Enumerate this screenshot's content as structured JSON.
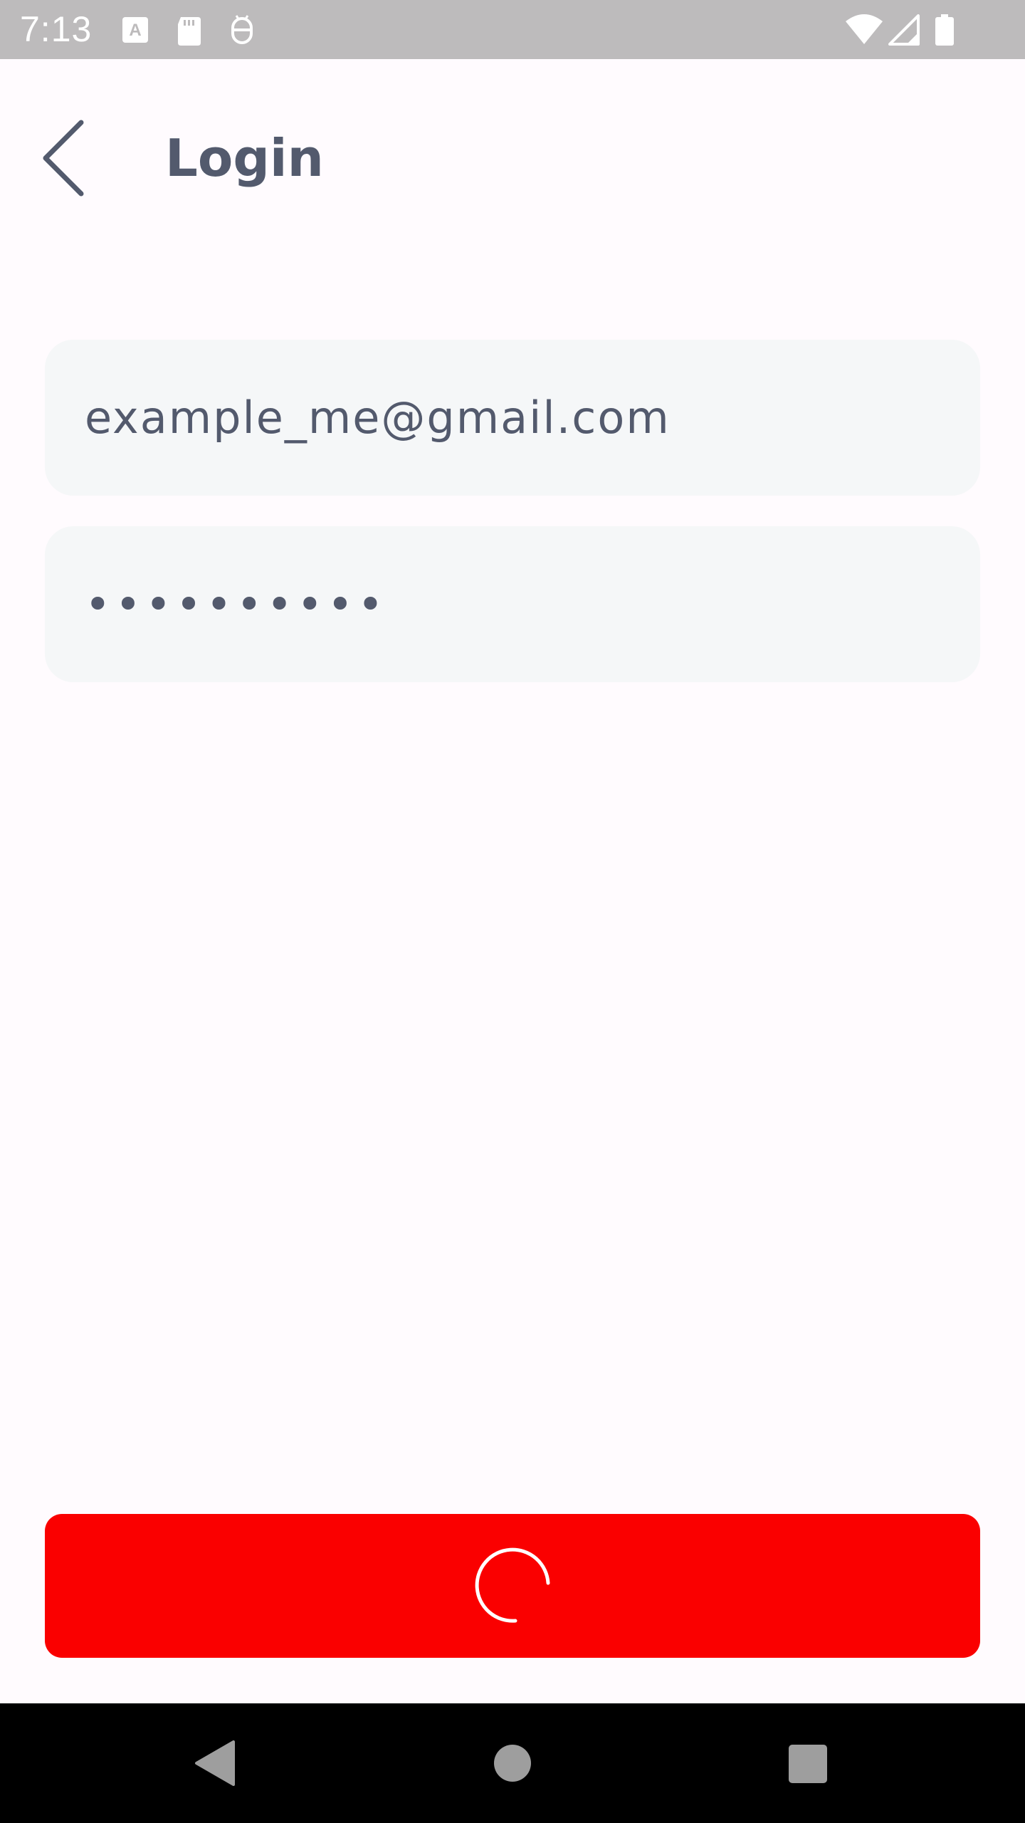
{
  "status_bar": {
    "time": "7:13",
    "left_icons": [
      "text-a-icon",
      "sd-card-icon",
      "debug-icon"
    ],
    "right_icons": [
      "wifi-icon",
      "cell-signal-icon",
      "battery-icon"
    ]
  },
  "header": {
    "back_icon": "chevron-left-icon",
    "title": "Login"
  },
  "form": {
    "email_value": "example_me@gmail.com",
    "password_value": "••••••••••",
    "submit_state": "loading-spinner"
  },
  "nav_bar": {
    "buttons": [
      "back-triangle-icon",
      "home-circle-icon",
      "recents-square-icon"
    ]
  },
  "colors": {
    "background": "#fffbfe",
    "status_bar": "#bdbbbc",
    "text": "#535a6d",
    "input_bg": "#f5f7f8",
    "accent": "#fa0000",
    "nav_bar": "#000000"
  }
}
